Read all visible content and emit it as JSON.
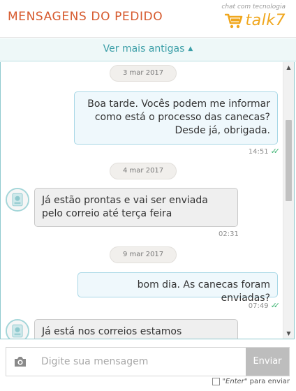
{
  "header": {
    "title": "MENSAGENS DO PEDIDO",
    "brand_caption": "chat com tecnologia",
    "brand_name": "talk7",
    "brand_icon": "shopping-cart-icon",
    "brand_color": "#f0a71e",
    "title_color": "#d65a2e"
  },
  "history": {
    "load_older_label": "Ver mais antigas",
    "load_older_icon": "chevron-up-icon"
  },
  "thread": {
    "date_separators": [
      "3 mar 2017",
      "4 mar 2017",
      "9 mar 2017"
    ],
    "messages": [
      {
        "direction": "outgoing",
        "lines": [
          "Boa tarde. Vocês podem me informar",
          "como está o processo das canecas?",
          "Desde já, obrigada."
        ],
        "time": "14:51",
        "status_icon": "double-check-icon"
      },
      {
        "direction": "incoming",
        "lines": [
          "Já estão prontas e vai ser enviada",
          "pelo correio até terça feira"
        ],
        "time": "02:31",
        "avatar_icon": "store-avatar-icon"
      },
      {
        "direction": "outgoing",
        "lines": [
          "bom dia. As canecas foram enviadas?"
        ],
        "time": "07:49",
        "status_icon": "double-check-icon"
      },
      {
        "direction": "incoming",
        "lines": [
          "Já está nos correios estamos"
        ],
        "avatar_icon": "store-avatar-icon"
      }
    ]
  },
  "composer": {
    "attach_icon": "camera-icon",
    "input_value": "",
    "input_placeholder": "Digite sua mensagem",
    "send_label": "Enviar",
    "enter_option": {
      "checked": false,
      "label_prefix": "\"Enter\"",
      "label_suffix": " para enviar"
    }
  },
  "colors": {
    "outgoing_bubble": "#eff8fc",
    "incoming_bubble": "#efefef",
    "read_ticks": "#3cb371",
    "accent_teal": "#3c9fa8",
    "send_button": "#bdbdbd"
  }
}
